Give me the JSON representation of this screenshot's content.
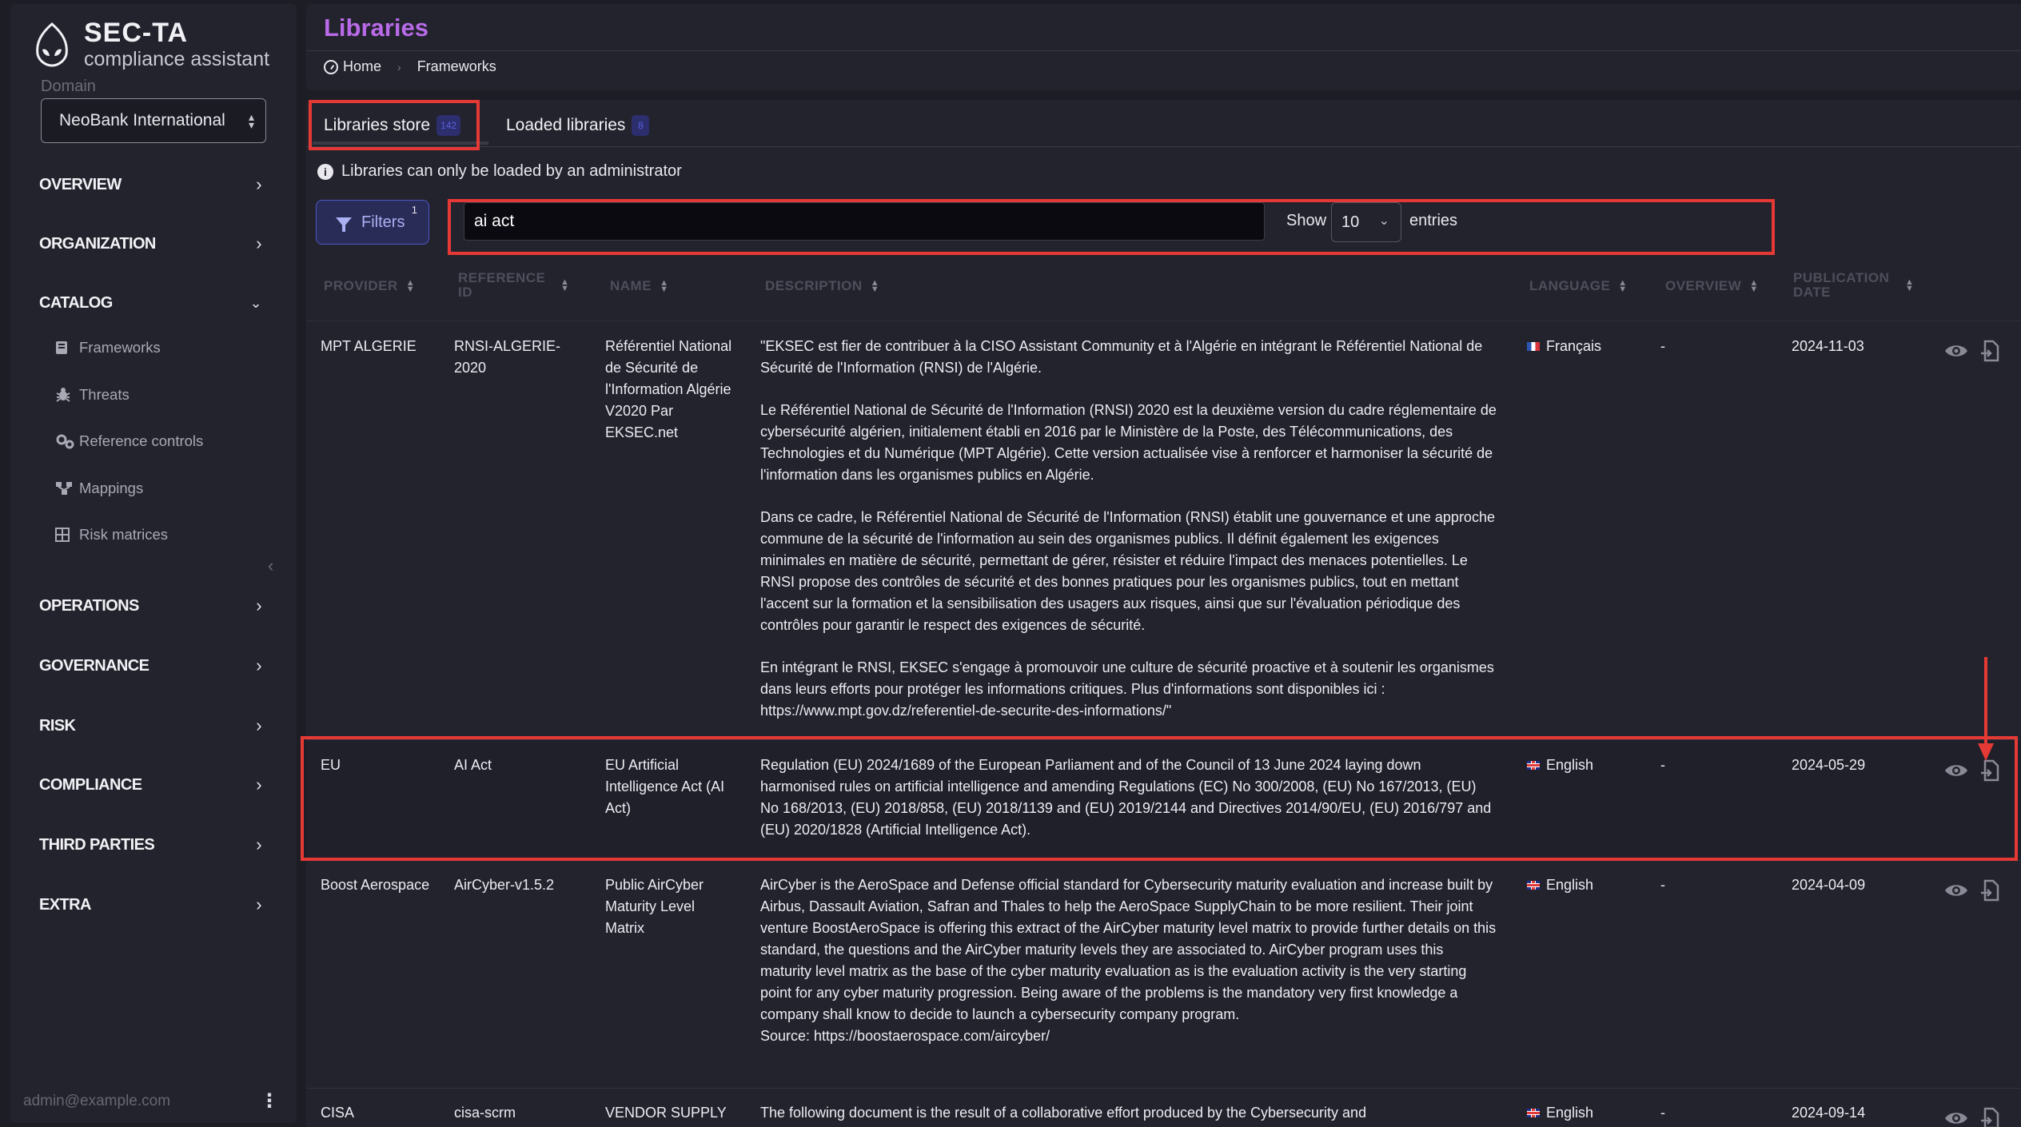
{
  "app": {
    "title": "SEC-TA",
    "subtitle": "compliance assistant",
    "domain_label": "Domain",
    "domain_value": "NeoBank International"
  },
  "sidebar": {
    "nav": [
      {
        "label": "OVERVIEW"
      },
      {
        "label": "ORGANIZATION"
      },
      {
        "label": "CATALOG"
      },
      {
        "label": "OPERATIONS"
      },
      {
        "label": "GOVERNANCE"
      },
      {
        "label": "RISK"
      },
      {
        "label": "COMPLIANCE"
      },
      {
        "label": "THIRD PARTIES"
      },
      {
        "label": "EXTRA"
      }
    ],
    "catalog_items": [
      {
        "label": "Frameworks",
        "icon": "book-icon"
      },
      {
        "label": "Threats",
        "icon": "bug-icon"
      },
      {
        "label": "Reference controls",
        "icon": "gears-icon"
      },
      {
        "label": "Mappings",
        "icon": "sitemap-icon"
      },
      {
        "label": "Risk matrices",
        "icon": "grid-icon"
      }
    ],
    "user_email": "admin@example.com"
  },
  "header": {
    "title": "Libraries",
    "breadcrumb": [
      "Home",
      "Frameworks"
    ]
  },
  "tabs": [
    {
      "label": "Libraries store",
      "count": "142"
    },
    {
      "label": "Loaded libraries",
      "count": "8"
    }
  ],
  "notice": "Libraries can only be loaded by an administrator",
  "filters": {
    "label": "Filters",
    "count": "1"
  },
  "search": {
    "value": "ai act"
  },
  "pagination": {
    "show_label": "Show",
    "page_size": "10",
    "entries_label": "entries"
  },
  "table": {
    "columns": [
      "PROVIDER",
      "REFERENCE ID",
      "NAME",
      "DESCRIPTION",
      "LANGUAGE",
      "OVERVIEW",
      "PUBLICATION DATE"
    ],
    "rows": [
      {
        "provider": "MPT ALGERIE",
        "ref_id": "RNSI-ALGERIE-2020",
        "name": "Référentiel National de Sécurité de l'Information Algérie V2020 Par EKSEC.net",
        "description": [
          "\"EKSEC est fier de contribuer à la CISO Assistant Community et à l'Algérie en intégrant le Référentiel National de Sécurité de l'Information (RNSI) de l'Algérie.",
          "Le Référentiel National de Sécurité de l'Information (RNSI) 2020 est la deuxième version du cadre réglementaire de cybersécurité algérien, initialement établi en 2016 par le Ministère de la Poste, des Télécommunications, des Technologies et du Numérique (MPT Algérie). Cette version actualisée vise à renforcer et harmoniser la sécurité de l'information dans les organismes publics en Algérie.",
          "Dans ce cadre, le Référentiel National de Sécurité de l'Information (RNSI) établit une gouvernance et une approche commune de la sécurité de l'information au sein des organismes publics. Il définit également les exigences minimales en matière de sécurité, permettant de gérer, résister et réduire l'impact des menaces potentielles. Le RNSI propose des contrôles de sécurité et des bonnes pratiques pour les organismes publics, tout en mettant l'accent sur la formation et la sensibilisation des usagers aux risques, ainsi que sur l'évaluation périodique des contrôles pour garantir le respect des exigences de sécurité.",
          "En intégrant le RNSI, EKSEC s'engage à promouvoir une culture de sécurité proactive et à soutenir les organismes dans leurs efforts pour protéger les informations critiques. Plus d'informations sont disponibles ici : https://www.mpt.gov.dz/referentiel-de-securite-des-informations/\""
        ],
        "language": "Français",
        "overview": "-",
        "date": "2024-11-03"
      },
      {
        "provider": "EU",
        "ref_id": "AI Act",
        "name": "EU Artificial Intelligence Act (AI Act)",
        "description": [
          "Regulation (EU) 2024/1689 of the European Parliament and of the Council of 13 June 2024 laying down harmonised rules on artificial intelligence and amending Regulations (EC) No 300/2008, (EU) No 167/2013, (EU) No 168/2013, (EU) 2018/858, (EU) 2018/1139 and (EU) 2019/2144 and Directives 2014/90/EU, (EU) 2016/797 and (EU) 2020/1828 (Artificial Intelligence Act)."
        ],
        "language": "English",
        "overview": "-",
        "date": "2024-05-29"
      },
      {
        "provider": "Boost Aerospace",
        "ref_id": "AirCyber-v1.5.2",
        "name": "Public AirCyber Maturity Level Matrix",
        "description": [
          "AirCyber is the AeroSpace and Defense official standard for Cybersecurity maturity evaluation and increase built by Airbus, Dassault Aviation, Safran and Thales to help the AeroSpace SupplyChain to be more resilient. Their joint venture BoostAeroSpace is offering this extract of the AirCyber maturity level matrix to provide further details on this standard, the questions and the AirCyber maturity levels they are associated to. AirCyber program uses this maturity level matrix as the base of the cyber maturity evaluation as is the evaluation activity is the very starting point for any cyber maturity progression. Being aware of the problems is the mandatory very first knowledge a company shall know to decide to launch a cybersecurity company program.",
          "Source: https://boostaerospace.com/aircyber/"
        ],
        "language": "English",
        "overview": "-",
        "date": "2024-04-09"
      },
      {
        "provider": "CISA",
        "ref_id": "cisa-scrm",
        "name": "VENDOR SUPPLY",
        "description": [
          "The following document is the result of a collaborative effort produced by the Cybersecurity and"
        ],
        "language": "English",
        "overview": "-",
        "date": "2024-09-14"
      }
    ]
  },
  "colors": {
    "accent": "#b96ae8",
    "highlight": "#e53935",
    "filter": "#4d57c7"
  }
}
